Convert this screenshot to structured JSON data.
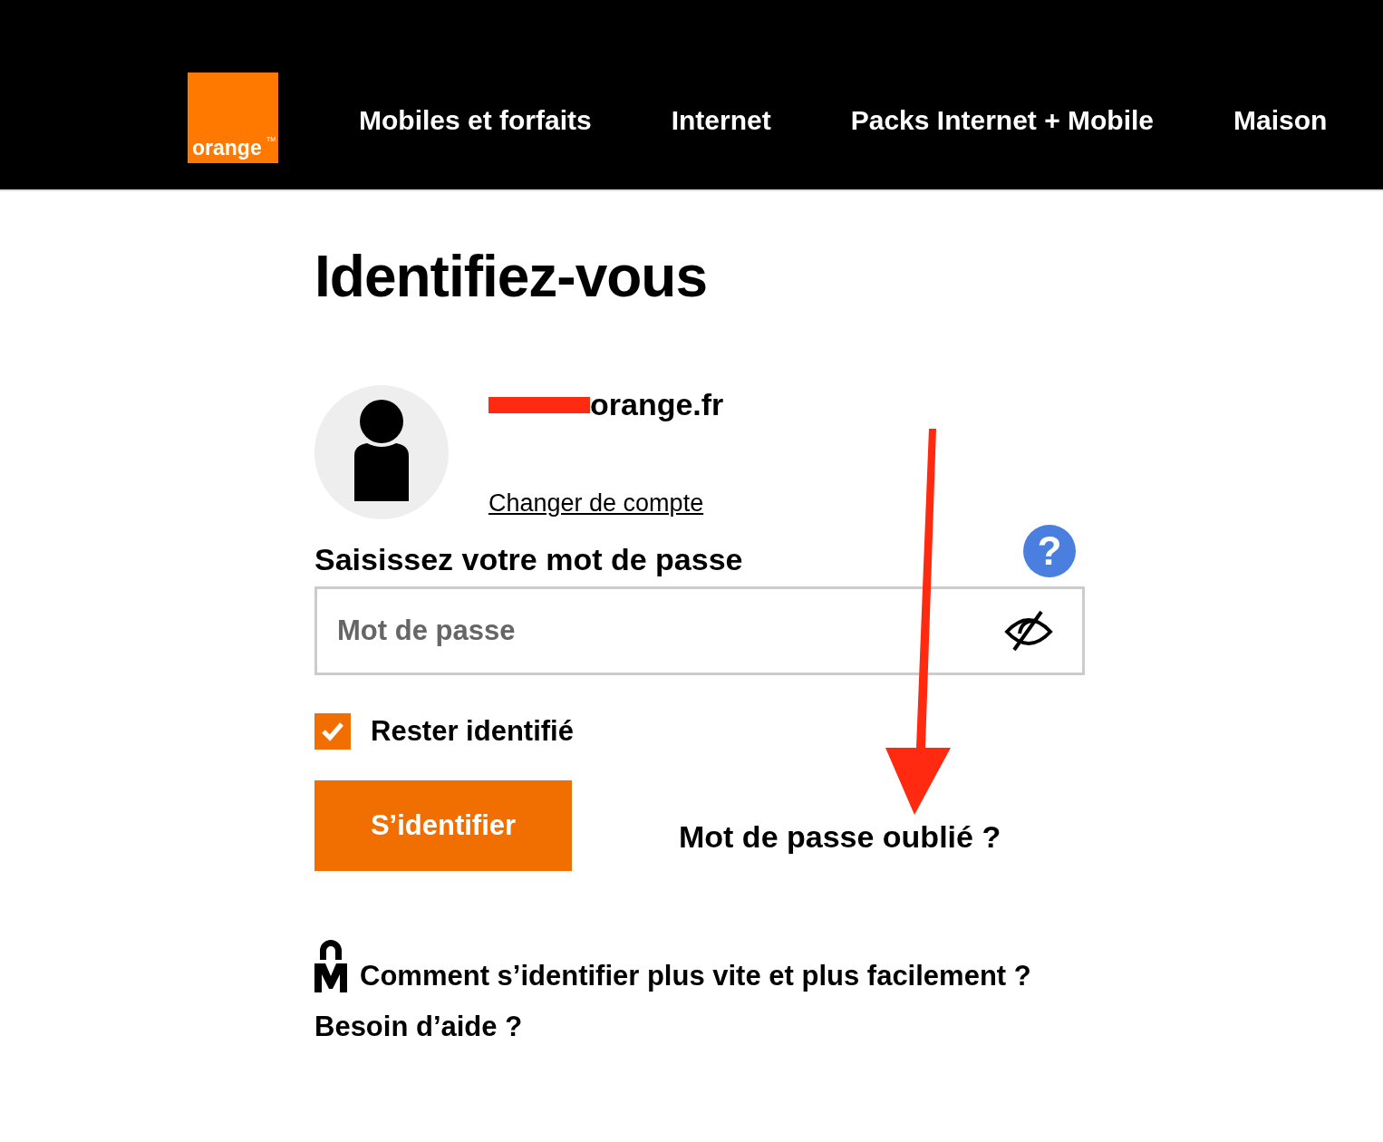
{
  "header": {
    "logo": {
      "text": "orange",
      "trademark": "TM"
    },
    "nav": [
      {
        "label": "Mobiles et forfaits"
      },
      {
        "label": "Internet"
      },
      {
        "label": "Packs Internet + Mobile"
      },
      {
        "label": "Maison"
      }
    ]
  },
  "title": "Identifiez-vous",
  "account": {
    "email": "orange.fr",
    "redacted": true,
    "change_link": "Changer de compte"
  },
  "password": {
    "label": "Saisissez votre mot de passe",
    "help": "?",
    "placeholder": "Mot de passe"
  },
  "remember": {
    "label": "Rester identifié",
    "checked": true
  },
  "submit": "S’identifier",
  "forgot": "Mot de passe oublié ?",
  "links": [
    {
      "kind": "icon",
      "label": "Comment s’identifier plus vite et plus facilement ?"
    },
    {
      "kind": "plain",
      "label": "Besoin d’aide ?"
    }
  ],
  "annotation": {
    "kind": "arrow"
  }
}
